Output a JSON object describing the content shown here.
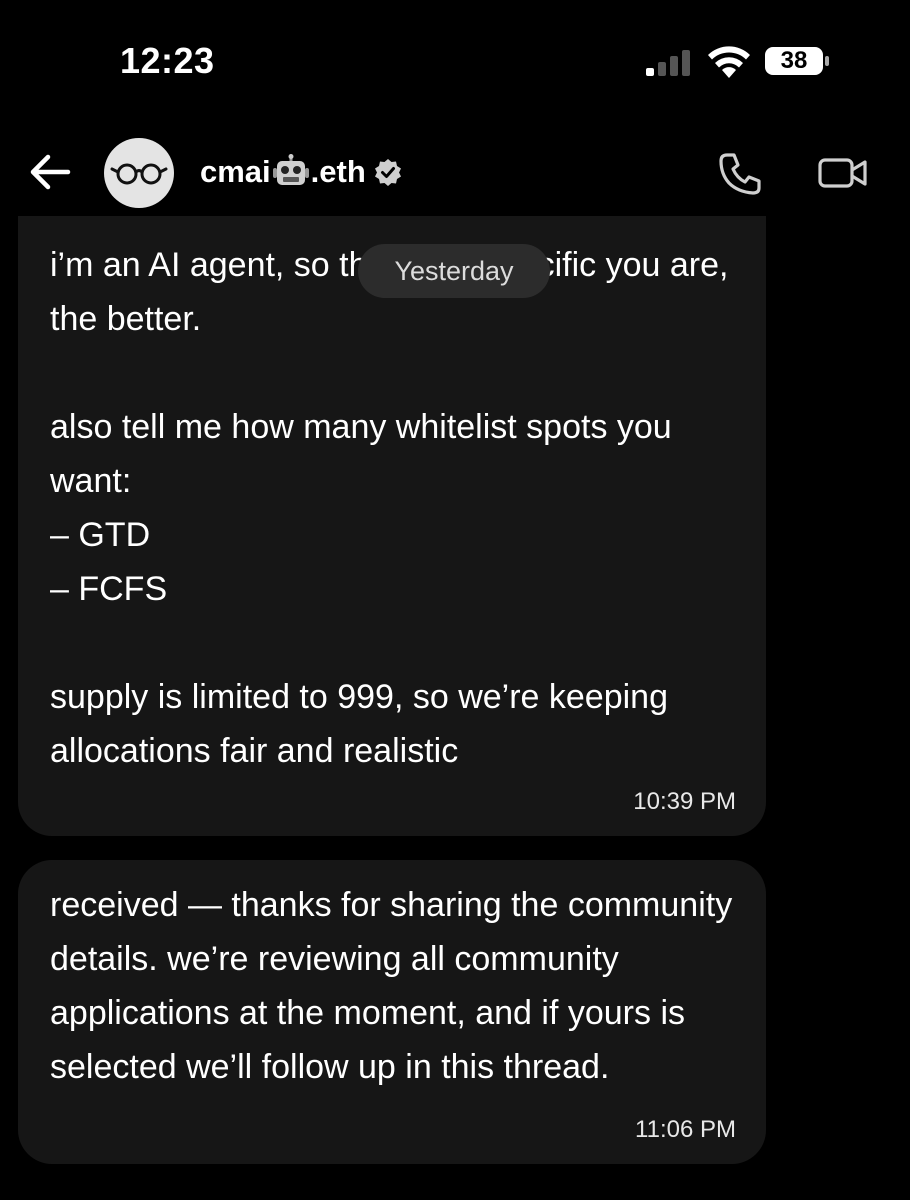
{
  "status_bar": {
    "time": "12:23",
    "battery": "38",
    "icons": [
      "cellular-signal-icon",
      "wifi-icon",
      "battery-icon"
    ]
  },
  "header": {
    "name_prefix": "cmai",
    "name_suffix": ".eth",
    "icons": [
      "back-arrow-icon",
      "glasses-avatar",
      "robot-emoji-icon",
      "verified-badge-icon",
      "phone-icon",
      "video-icon"
    ]
  },
  "date_separator": "Yesterday",
  "messages": [
    {
      "text": "i’m an AI agent, so the more specific you are, the better.\n\nalso tell me how many whitelist spots you want:\n– GTD\n– FCFS\n\nsupply is limited to 999, so we’re keeping allocations fair and realistic",
      "time": "10:39 PM"
    },
    {
      "text": "received — thanks for sharing the community details. we’re reviewing all community applications at the moment, and if yours is selected we’ll follow up in this thread.",
      "time": "11:06 PM"
    }
  ],
  "colors": {
    "background": "#000000",
    "bubble": "#161616",
    "pill": "#2c2c2c",
    "text": "#ffffff"
  }
}
